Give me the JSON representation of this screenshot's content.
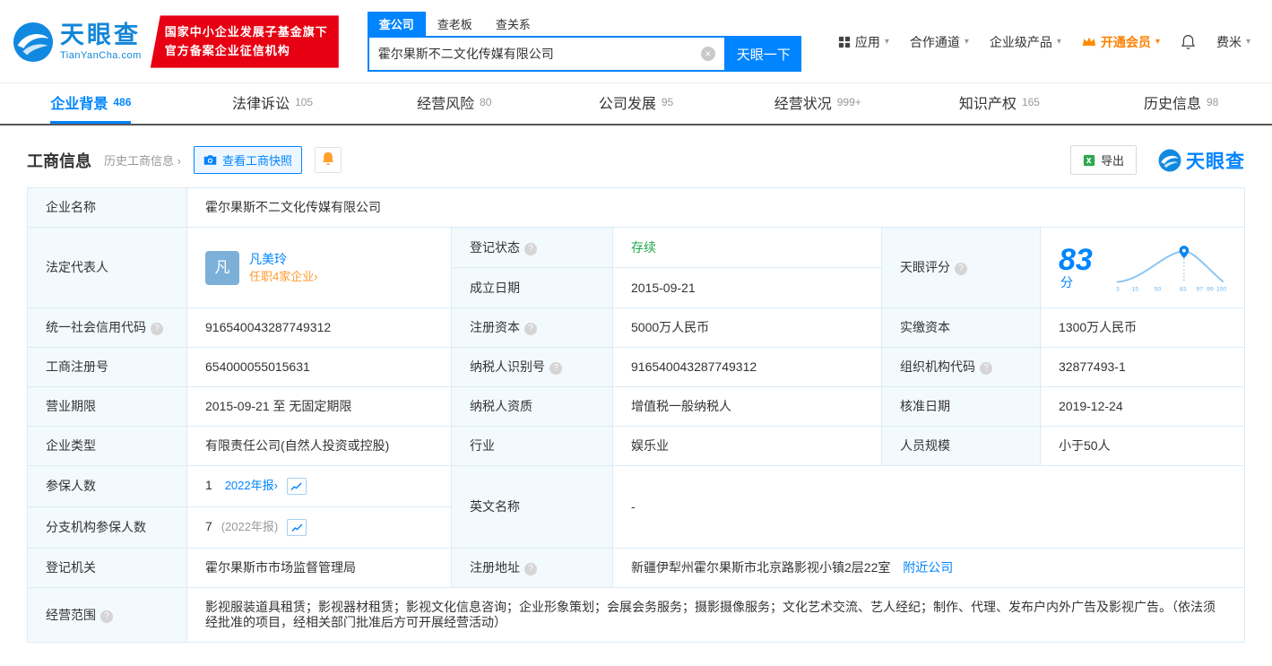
{
  "icons": {
    "question": "?",
    "caret": "▾",
    "arrow": "›",
    "clear": "×"
  },
  "header": {
    "logo": {
      "brand": "天眼查",
      "domain": "TianYanCha.com"
    },
    "badge": {
      "line1": "国家中小企业发展子基金旗下",
      "line2": "官方备案企业征信机构"
    },
    "search": {
      "tab_company": "查公司",
      "tab_boss": "查老板",
      "tab_relation": "查关系",
      "value": "霍尔果斯不二文化传媒有限公司",
      "button": "天眼一下"
    },
    "nav": {
      "apps": "应用",
      "cooperation": "合作通道",
      "enterprise": "企业级产品",
      "vip": "开通会员",
      "user": "费米"
    }
  },
  "nav_tabs": [
    {
      "label": "企业背景",
      "count": "486"
    },
    {
      "label": "法律诉讼",
      "count": "105"
    },
    {
      "label": "经营风险",
      "count": "80"
    },
    {
      "label": "公司发展",
      "count": "95"
    },
    {
      "label": "经营状况",
      "count": "999+"
    },
    {
      "label": "知识产权",
      "count": "165"
    },
    {
      "label": "历史信息",
      "count": "98"
    }
  ],
  "toolbar": {
    "title": "工商信息",
    "history": "历史工商信息",
    "snapshot": "查看工商快照",
    "export": "导出",
    "brand": "天眼查"
  },
  "labels": {
    "company_name": "企业名称",
    "legal_rep": "法定代表人",
    "reg_status": "登记状态",
    "establish_date": "成立日期",
    "score": "天眼评分",
    "credit_code": "统一社会信用代码",
    "reg_capital": "注册资本",
    "paid_capital": "实缴资本",
    "reg_number": "工商注册号",
    "taxpayer_id": "纳税人识别号",
    "org_code": "组织机构代码",
    "business_term": "营业期限",
    "taxpayer_quality": "纳税人资质",
    "approval_date": "核准日期",
    "company_type": "企业类型",
    "industry": "行业",
    "staff_size": "人员规模",
    "insured_count": "参保人数",
    "english_name": "英文名称",
    "branch_insured": "分支机构参保人数",
    "reg_authority": "登记机关",
    "reg_address": "注册地址",
    "business_scope": "经营范围"
  },
  "company": {
    "name": "霍尔果斯不二文化传媒有限公司",
    "legal_rep_avatar": "凡",
    "legal_rep_name": "凡美玲",
    "legal_rep_link": "任职4家企业",
    "reg_status": "存续",
    "establish_date": "2015-09-21",
    "score_value": "83",
    "score_unit": "分",
    "credit_code": "916540043287749312",
    "reg_capital": "5000万人民币",
    "paid_capital": "1300万人民币",
    "reg_number": "654000055015631",
    "taxpayer_id": "916540043287749312",
    "org_code": "32877493-1",
    "business_term": "2015-09-21 至 无固定期限",
    "taxpayer_quality": "增值税一般纳税人",
    "approval_date": "2019-12-24",
    "company_type": "有限责任公司(自然人投资或控股)",
    "industry": "娱乐业",
    "staff_size": "小于50人",
    "insured_count": "1",
    "insured_report": "2022年报",
    "english_name": "-",
    "branch_insured_count": "7",
    "branch_insured_report": "(2022年报)",
    "reg_authority": "霍尔果斯市市场监督管理局",
    "reg_address": "新疆伊犁州霍尔果斯市北京路影视小镇2层22室",
    "nearby_link": "附近公司",
    "business_scope": "影视服装道具租赁；影视器材租赁；影视文化信息咨询；企业形象策划；会展会务服务；摄影摄像服务；文化艺术交流、艺人经纪；制作、代理、发布户内外广告及影视广告。（依法须经批准的项目，经相关部门批准后方可开展经营活动）"
  },
  "score_chart": {
    "ticks": [
      "3",
      "15",
      "50",
      "83",
      "97",
      "99",
      "100"
    ]
  },
  "colors": {
    "brand_blue": "#0084ff",
    "badge_red": "#e60012",
    "vip_orange": "#ff8000",
    "status_green": "#21a84c",
    "link_orange": "#ff9a2f"
  }
}
